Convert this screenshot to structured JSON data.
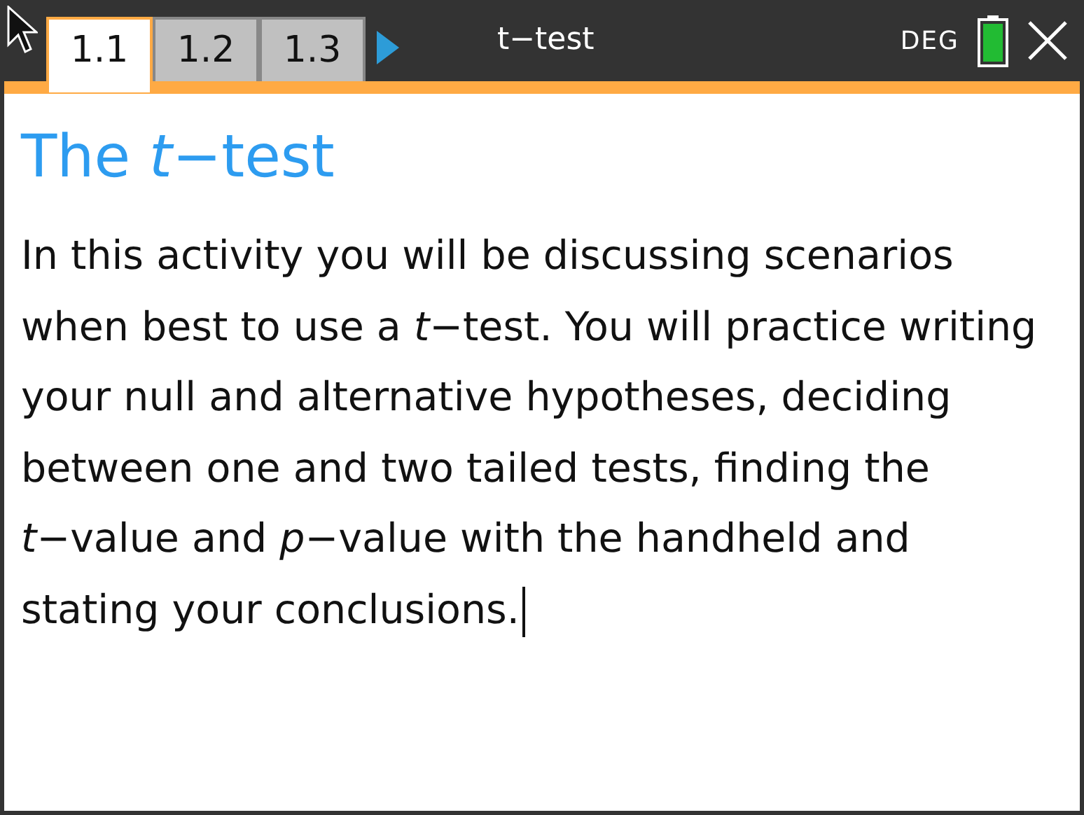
{
  "tabs": [
    {
      "label": "1.1",
      "selected": true
    },
    {
      "label": "1.2",
      "selected": false
    },
    {
      "label": "1.3",
      "selected": false
    }
  ],
  "document_title": "t−test",
  "angle_mode": "DEG",
  "page": {
    "heading": "The *t*−test",
    "body": "In this activity you will be discussing scenarios when best to use a *t*−test. You will practice writing your null and alternative hypotheses, deciding between one and two tailed tests, finding the *t*−value and *p*−value with the handheld and stating your conclusions."
  }
}
